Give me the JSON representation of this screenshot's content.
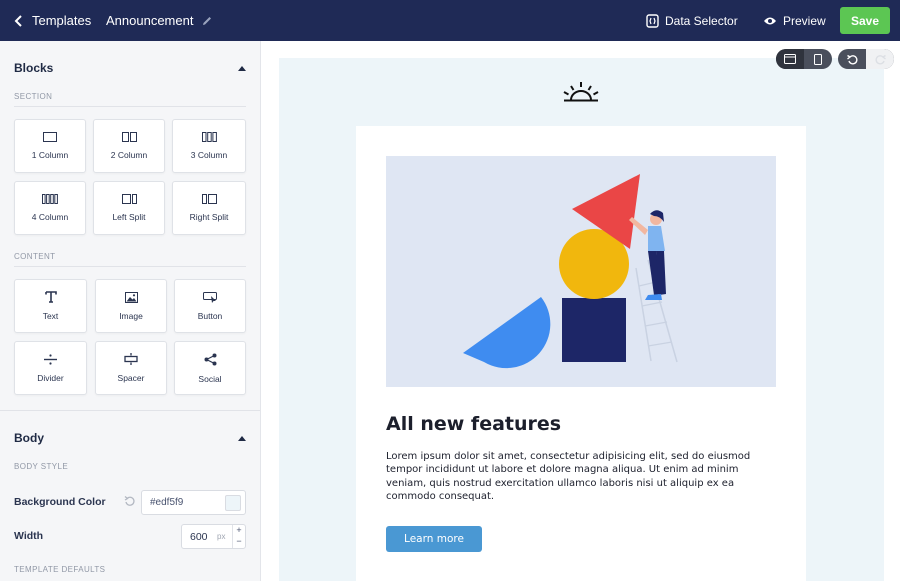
{
  "topbar": {
    "back_label": "Templates",
    "doc_title": "Announcement",
    "data_selector_label": "Data Selector",
    "preview_label": "Preview",
    "save_label": "Save"
  },
  "sidebar": {
    "blocks_title": "Blocks",
    "section_label": "SECTION",
    "section_tiles": [
      {
        "label": "1 Column",
        "icon": "one-column-icon"
      },
      {
        "label": "2 Column",
        "icon": "two-column-icon"
      },
      {
        "label": "3 Column",
        "icon": "three-column-icon"
      },
      {
        "label": "4 Column",
        "icon": "four-column-icon"
      },
      {
        "label": "Left Split",
        "icon": "left-split-icon"
      },
      {
        "label": "Right Split",
        "icon": "right-split-icon"
      }
    ],
    "content_label": "CONTENT",
    "content_tiles": [
      {
        "label": "Text",
        "icon": "text-icon"
      },
      {
        "label": "Image",
        "icon": "image-icon"
      },
      {
        "label": "Button",
        "icon": "button-icon"
      },
      {
        "label": "Divider",
        "icon": "divider-icon"
      },
      {
        "label": "Spacer",
        "icon": "spacer-icon"
      },
      {
        "label": "Social",
        "icon": "share-icon"
      }
    ],
    "body_title": "Body",
    "body_style_label": "BODY STYLE",
    "background_color_label": "Background Color",
    "background_color_value": "#edf5f9",
    "width_label": "Width",
    "width_value": "600",
    "width_unit": "px",
    "template_defaults_label": "TEMPLATE DEFAULTS"
  },
  "email": {
    "headline": "All new features",
    "body": "Lorem ipsum dolor sit amet, consectetur adipisicing elit, sed do eiusmod tempor incididunt ut labore et dolore magna aliqua. Ut enim ad minim veniam, quis nostrud exercitation ullamco laboris nisi ut aliquip ex ea commodo consequat.",
    "cta_label": "Learn more"
  },
  "colors": {
    "topbar": "#1f2a56",
    "save": "#5cc653",
    "canvas_bg": "#edf5f9",
    "cta": "#4a98d3"
  }
}
